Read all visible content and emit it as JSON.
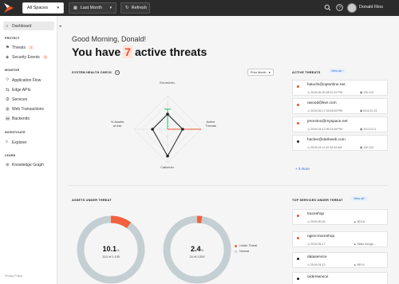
{
  "topbar": {
    "spaces_select": "All Spaces",
    "time_select": "Last Month",
    "refresh_label": "Refresh",
    "user_name": "Donald Rios",
    "icons": [
      "search-icon",
      "help-icon",
      "avatar"
    ]
  },
  "sidebar": {
    "dashboard": "Dashboard",
    "section_protect": "PROTECT",
    "threats": "Threats",
    "threats_count": "7",
    "security_events": "Security Events",
    "security_events_count": "0",
    "section_monitor": "MONITOR",
    "application_flow": "Application Flow",
    "edge_apis": "Edge APIs",
    "services": "Services",
    "web_transactions": "Web Transactions",
    "backends": "Backends",
    "section_investigate": "INVESTIGATE",
    "explorer": "Explorer",
    "section_learn": "LEARN",
    "knowledge_graph": "Knowledge Graph",
    "footer": "Privacy Policy"
  },
  "main": {
    "greeting": "Good Morning, Donald!",
    "headline_pre": "You have",
    "headline_num": "7",
    "headline_post": "active threats"
  },
  "health": {
    "title": "SYSTEM HEALTH CHECK",
    "period": "Prior Month",
    "axes": [
      "Errors/min",
      "Active Threats",
      "Calls/min",
      "% Assets at risk"
    ],
    "label_top": "Errors/min.",
    "label_right_1": "Active",
    "label_right_2": "Threats",
    "label_bottom": "Calls/min.",
    "label_left_1": "% Assets",
    "label_left_2": "at risk",
    "current": [
      0.45,
      0.45,
      0.8,
      0.45
    ],
    "prior": [
      0.6,
      0.2,
      0.2,
      0.2
    ],
    "colors": {
      "current": "#222222",
      "prior_green": "#2bb673",
      "prior_red": "#e8532d"
    }
  },
  "active_threats": {
    "title": "ACTIVE THREATS",
    "view_all": "View all",
    "items": [
      {
        "email": "fukuchi@optonline.net",
        "time": "2019-05-30 08:12:22 PM",
        "ip": "100.112",
        "color": "#e8532d"
      },
      {
        "email": "owood@live.com",
        "time": "2019-05-17 03:26:53 PM",
        "ip": "63.6.01.23",
        "color": "#e8532d"
      },
      {
        "email": "jeronimo@myspace.net",
        "time": "2019-04-12 06:24:48 PM",
        "ip": "10.0.0.0.2",
        "color": "#e8532d"
      },
      {
        "email": "hacker@darkweb.com",
        "time": "2019-04-11 02:34:34 AM",
        "ip": "100.112",
        "color": "#222222"
      }
    ],
    "more": "+ 3 more"
  },
  "assets": {
    "title": "ASSETS UNDER THREAT",
    "donut1_big": "10.1",
    "donut1_pct": "%",
    "donut1_small": "11/1 of 1,100",
    "donut1_value": 0.101,
    "donut2_big": "2.4",
    "donut2_pct": "%",
    "donut2_small": "24 of 1,000",
    "donut2_value": 0.024,
    "legend_threat": "Under Threat",
    "legend_normal": "Normal",
    "colors": {
      "threat": "#f0613e",
      "normal": "#c4cfd3"
    }
  },
  "services": {
    "title": "TOP SERVICES UNDER THREAT",
    "view_all": "View all",
    "items": [
      {
        "name": "traceshop",
        "time": "2019-05-30",
        "tag": "BOLA",
        "color": "#e8532d"
      },
      {
        "name": "nginx-traceshop",
        "time": "2019-05-17",
        "tag": "Mass Assign...",
        "color": "#e8532d"
      },
      {
        "name": "dataservice",
        "time": "2019-04-12",
        "tag": "BFLA",
        "color": "#222222"
      },
      {
        "name": "orderservice",
        "time": "",
        "tag": "",
        "color": "#222222"
      }
    ]
  }
}
